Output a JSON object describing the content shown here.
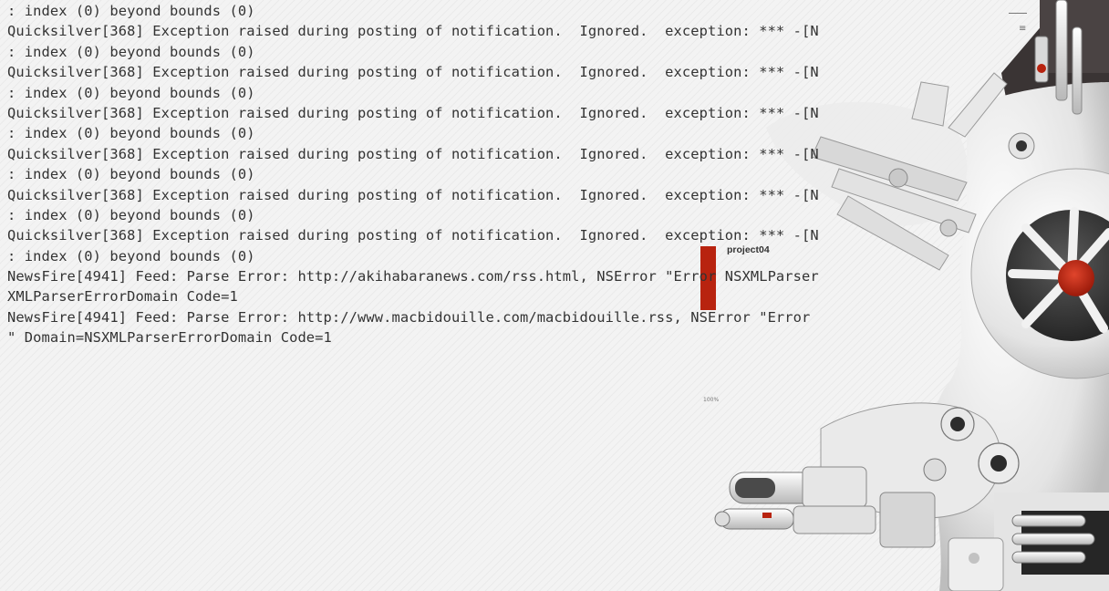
{
  "console": {
    "lines": [
      ": index (0) beyond bounds (0)",
      "Quicksilver[368] Exception raised during posting of notification.  Ignored.  exception: *** -[N",
      ": index (0) beyond bounds (0)",
      "Quicksilver[368] Exception raised during posting of notification.  Ignored.  exception: *** -[N",
      ": index (0) beyond bounds (0)",
      "Quicksilver[368] Exception raised during posting of notification.  Ignored.  exception: *** -[N",
      ": index (0) beyond bounds (0)",
      "Quicksilver[368] Exception raised during posting of notification.  Ignored.  exception: *** -[N",
      ": index (0) beyond bounds (0)",
      "Quicksilver[368] Exception raised during posting of notification.  Ignored.  exception: *** -[N",
      ": index (0) beyond bounds (0)",
      "Quicksilver[368] Exception raised during posting of notification.  Ignored.  exception: *** -[N",
      ": index (0) beyond bounds (0)",
      "NewsFire[4941] Feed: Parse Error: http://akihabaranews.com/rss.html, NSError \"Error NSXMLParser",
      "XMLParserErrorDomain Code=1",
      "NewsFire[4941] Feed: Parse Error: http://www.macbidouille.com/macbidouille.rss, NSError \"Error",
      "\" Domain=NSXMLParserErrorDomain Code=1"
    ]
  },
  "wallpaper": {
    "brand_text": "project04",
    "accent_color": "#b8230f",
    "zoom_hint": "100%"
  },
  "scroll_indicator": {
    "glyph": "≡"
  }
}
